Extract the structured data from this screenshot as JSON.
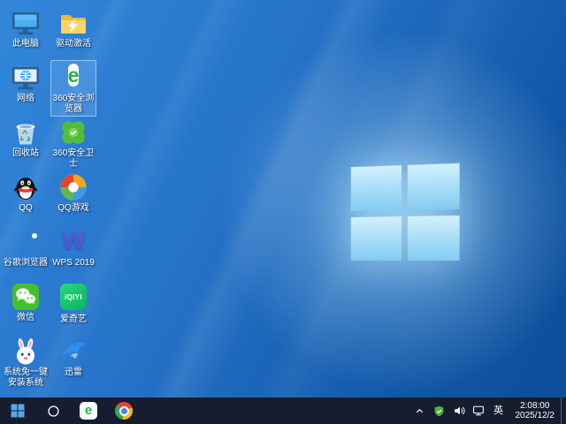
{
  "desktop": {
    "selected_icon": "360-browser",
    "icons": [
      {
        "name": "this-pc",
        "label": "此电脑",
        "col": 0,
        "row": 0,
        "selected": false
      },
      {
        "name": "driver-activate",
        "label": "驱动激活",
        "col": 1,
        "row": 0,
        "selected": false
      },
      {
        "name": "network",
        "label": "网络",
        "col": 0,
        "row": 1,
        "selected": false
      },
      {
        "name": "360-browser",
        "label": "360安全浏览器",
        "col": 1,
        "row": 1,
        "selected": true,
        "glyph": "e"
      },
      {
        "name": "recycle-bin",
        "label": "回收站",
        "col": 0,
        "row": 2,
        "selected": false
      },
      {
        "name": "360-safe",
        "label": "360安全卫士",
        "col": 1,
        "row": 2,
        "selected": false
      },
      {
        "name": "qq",
        "label": "QQ",
        "col": 0,
        "row": 3,
        "selected": false
      },
      {
        "name": "qq-games",
        "label": "QQ游戏",
        "col": 1,
        "row": 3,
        "selected": false
      },
      {
        "name": "chrome",
        "label": "谷歌浏览器",
        "col": 0,
        "row": 4,
        "selected": false
      },
      {
        "name": "wps",
        "label": "WPS 2019",
        "col": 1,
        "row": 4,
        "selected": false,
        "glyph": "W"
      },
      {
        "name": "wechat",
        "label": "微信",
        "col": 0,
        "row": 5,
        "selected": false
      },
      {
        "name": "iqiyi",
        "label": "爱奇艺",
        "col": 1,
        "row": 5,
        "selected": false,
        "glyph": "iQIYI"
      },
      {
        "name": "system-install",
        "label": "系统兔一键安装系统",
        "col": 0,
        "row": 6,
        "selected": false
      },
      {
        "name": "thunder",
        "label": "迅雷",
        "col": 1,
        "row": 6,
        "selected": false
      }
    ]
  },
  "taskbar": {
    "browser_glyph": "e",
    "ime_label": "英",
    "clock": {
      "time": "2:08:00",
      "date": "2025/12/2"
    }
  },
  "colors": {
    "wallpaper_top": "#3287da",
    "wallpaper_bottom": "#0d4c97",
    "logo_pane": "#a5dcf7",
    "taskbar_bg": "#151d2e",
    "selection": "#62a1e9"
  }
}
